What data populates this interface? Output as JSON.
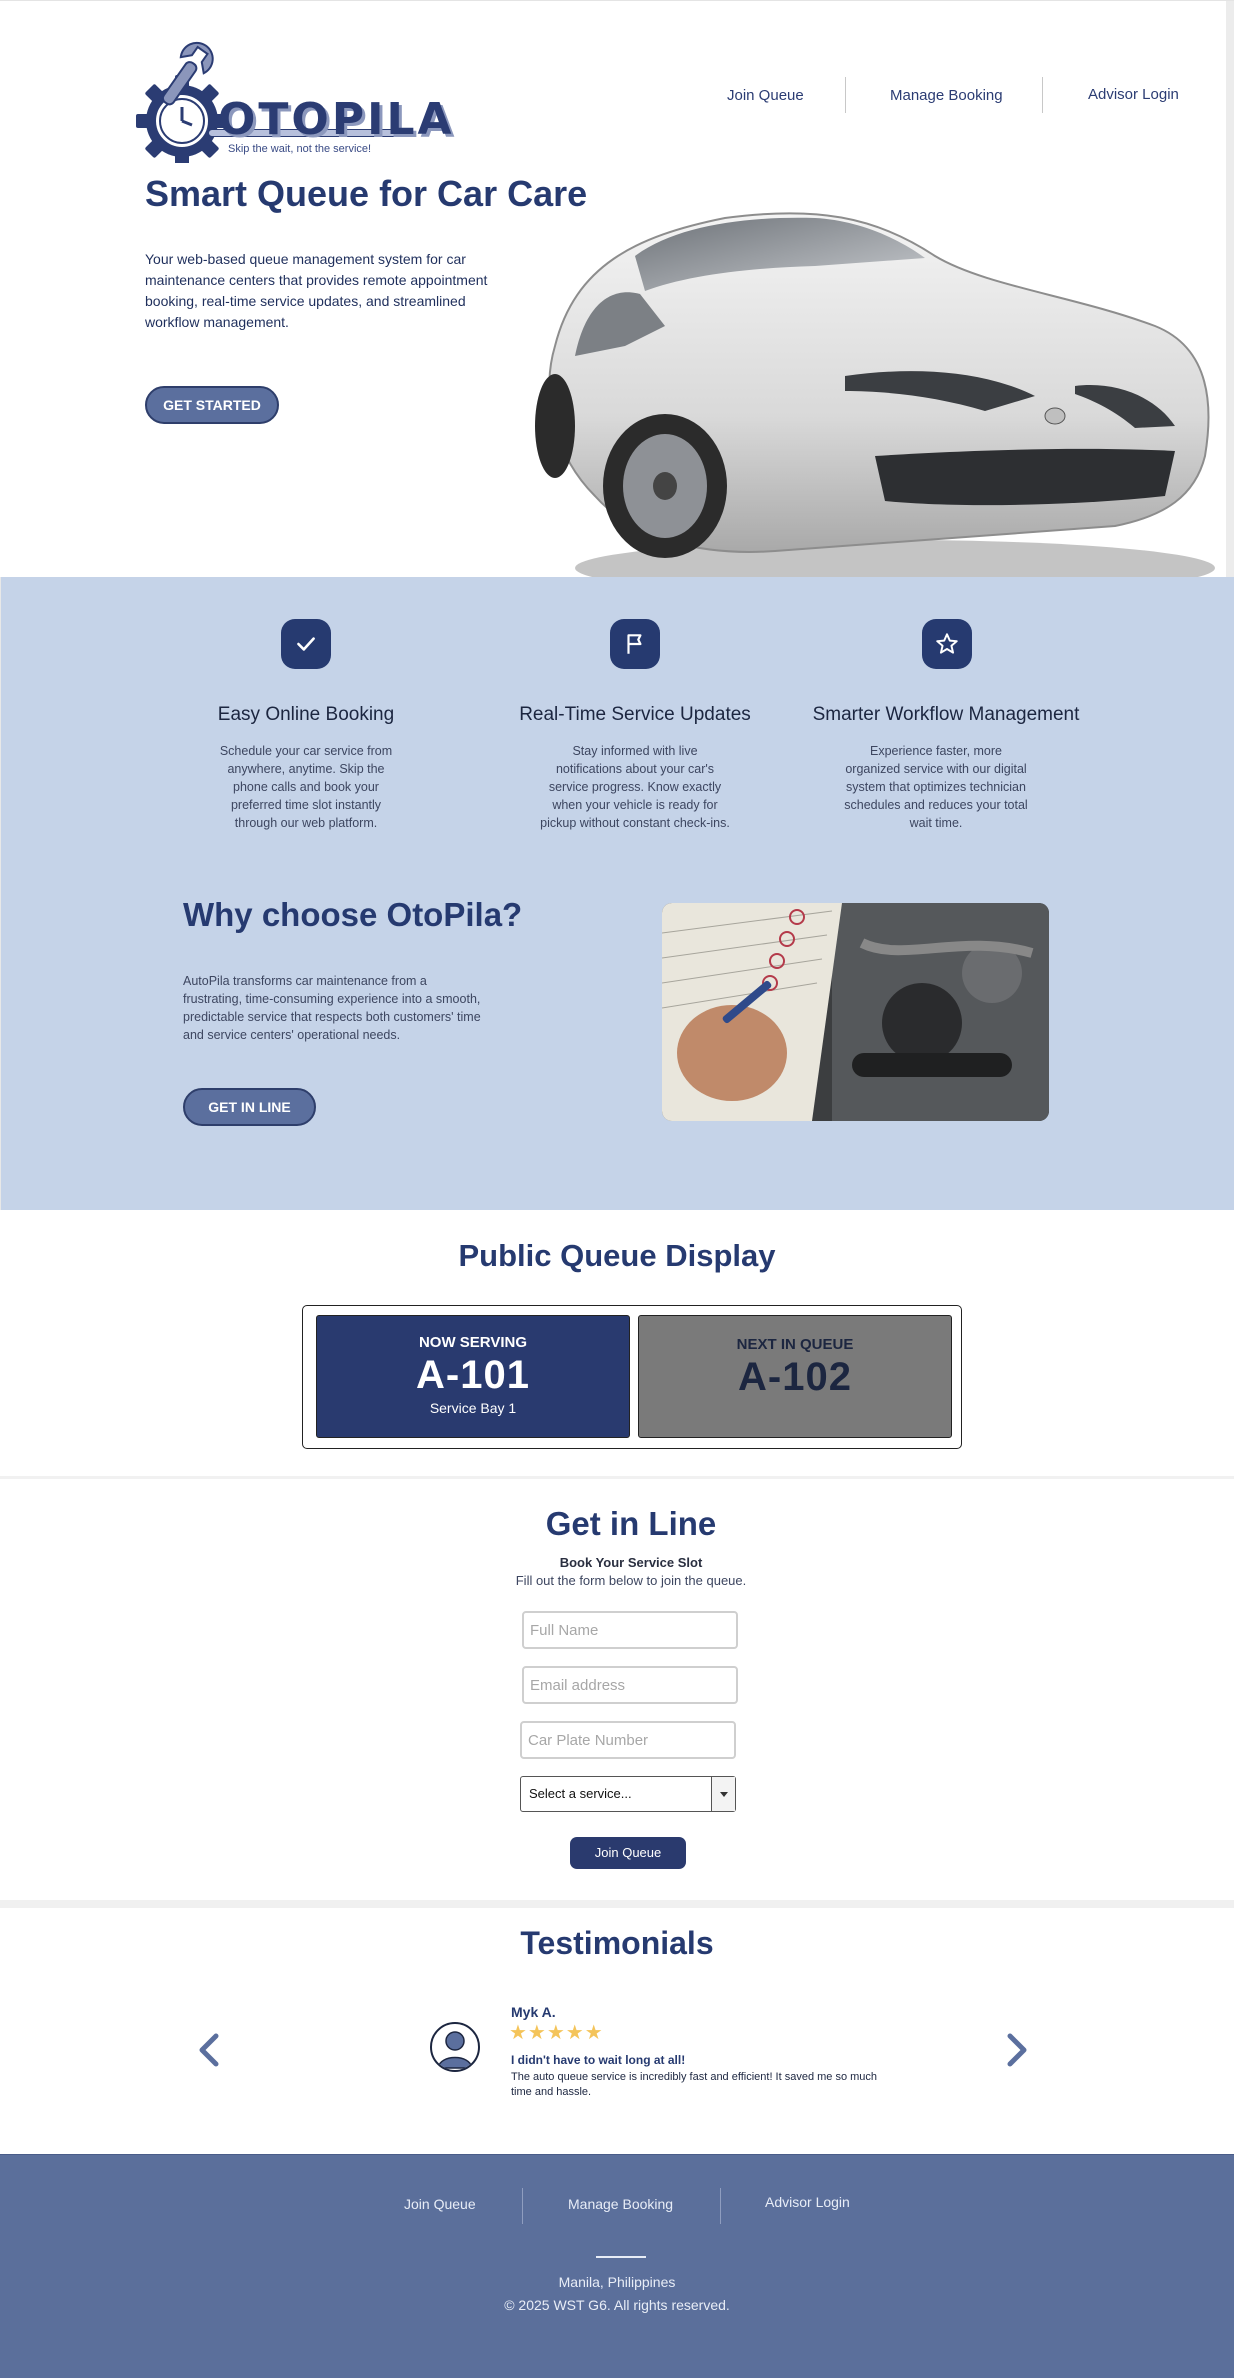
{
  "brand": {
    "name": "OTOPILA",
    "tagline": "Skip the wait, not the service!",
    "primary_color": "#263a70",
    "accent_color": "#5b6f9e",
    "band_color": "#c5d3e8"
  },
  "nav": {
    "items": [
      "Join Queue",
      "Manage Booking",
      "Advisor Login"
    ]
  },
  "hero": {
    "title": "Smart Queue for Car Care",
    "description": "Your web-based queue management system for car maintenance centers that provides remote appointment booking, real-time service updates, and streamlined workflow management.",
    "cta": "GET STARTED"
  },
  "features": [
    {
      "icon": "check-icon",
      "title": "Easy Online Booking",
      "text": "Schedule your car service from anywhere, anytime. Skip the phone calls and book your preferred time slot instantly through our web platform."
    },
    {
      "icon": "flag-icon",
      "title": "Real-Time Service Updates",
      "text": "Stay informed with live notifications about your car's service progress. Know exactly when your vehicle is ready for pickup without constant check-ins."
    },
    {
      "icon": "star-icon",
      "title": "Smarter Workflow Management",
      "text": "Experience faster, more organized service with our digital system that optimizes technician schedules and reduces your total wait time."
    }
  ],
  "why": {
    "title": "Why choose OtoPila?",
    "text": "AutoPila transforms car maintenance from a frustrating, time-consuming experience into a smooth, predictable service that respects both customers' time and service centers' operational needs.",
    "cta": "GET IN LINE"
  },
  "queue": {
    "title": "Public Queue Display",
    "now_serving": {
      "label": "NOW SERVING",
      "number": "A-101",
      "bay": "Service Bay 1",
      "color": "#293a6f"
    },
    "next": {
      "label": "NEXT IN QUEUE",
      "number": "A-102",
      "color": "#7a7a7a"
    }
  },
  "get_in_line": {
    "title": "Get in Line",
    "subtitle": "Book Your Service Slot",
    "note": "Fill out the form below to join the queue.",
    "name_placeholder": "Full Name",
    "email_placeholder": "Email address",
    "plate_placeholder": "Car Plate Number",
    "service_selected": "Select a service...",
    "submit": "Join Queue"
  },
  "testimonials": {
    "title": "Testimonials",
    "name": "Myk A.",
    "rating": 5,
    "stars": "★★★★★",
    "headline": "I didn't have to wait long at all!",
    "body": "The auto queue service is incredibly fast and efficient! It saved me so much time and hassle."
  },
  "footer": {
    "nav": [
      "Join Queue",
      "Manage Booking",
      "Advisor Login"
    ],
    "location": "Manila, Philippines",
    "copyright": "© 2025 WST G6.  All rights reserved."
  }
}
